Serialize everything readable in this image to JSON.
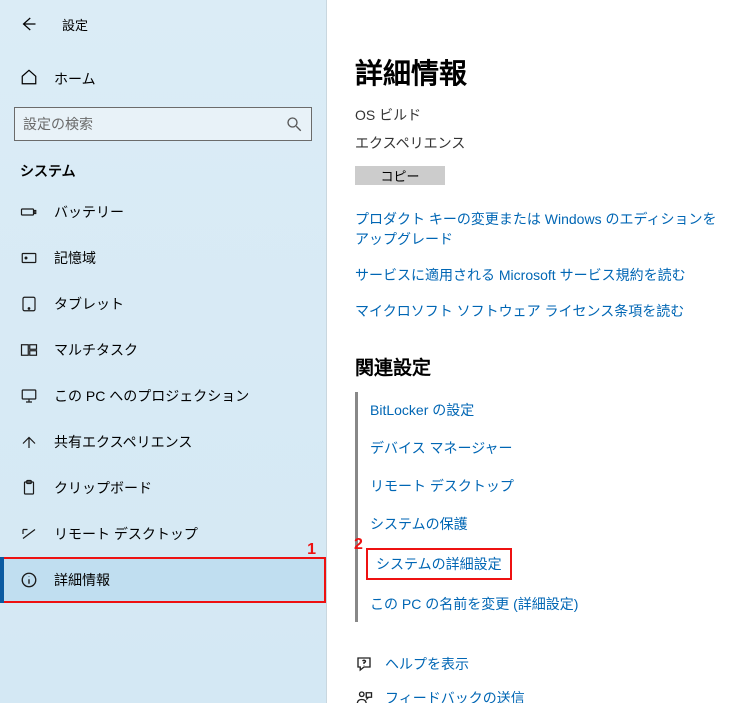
{
  "header": {
    "back": "←",
    "title": "設定"
  },
  "home": {
    "label": "ホーム"
  },
  "search": {
    "placeholder": "設定の検索"
  },
  "sidebar": {
    "section": "システム",
    "items": [
      {
        "label": "バッテリー",
        "icon": "battery-icon"
      },
      {
        "label": "記憶域",
        "icon": "storage-icon"
      },
      {
        "label": "タブレット",
        "icon": "tablet-icon"
      },
      {
        "label": "マルチタスク",
        "icon": "multitask-icon"
      },
      {
        "label": "この PC へのプロジェクション",
        "icon": "projection-icon"
      },
      {
        "label": "共有エクスペリエンス",
        "icon": "share-icon"
      },
      {
        "label": "クリップボード",
        "icon": "clipboard-icon"
      },
      {
        "label": "リモート デスクトップ",
        "icon": "remote-icon"
      },
      {
        "label": "詳細情報",
        "icon": "info-icon",
        "active": true
      }
    ]
  },
  "main": {
    "title": "詳細情報",
    "rows": [
      {
        "k": "OS ビルド",
        "v": ""
      },
      {
        "k": "エクスペリエンス",
        "v": ""
      }
    ],
    "copy": "コピー",
    "product_links": [
      "プロダクト キーの変更または Windows のエディションをアップグレード",
      "サービスに適用される Microsoft サービス規約を読む",
      "マイクロソフト ソフトウェア ライセンス条項を読む"
    ],
    "related_heading": "関連設定",
    "related_links": [
      "BitLocker の設定",
      "デバイス マネージャー",
      "リモート デスクトップ",
      "システムの保護",
      "システムの詳細設定",
      "この PC の名前を変更 (詳細設定)"
    ],
    "support": [
      {
        "icon": "help-icon",
        "label": "ヘルプを表示"
      },
      {
        "icon": "feedback-icon",
        "label": "フィードバックの送信"
      }
    ],
    "annotations": {
      "one": "1",
      "two": "2"
    }
  }
}
